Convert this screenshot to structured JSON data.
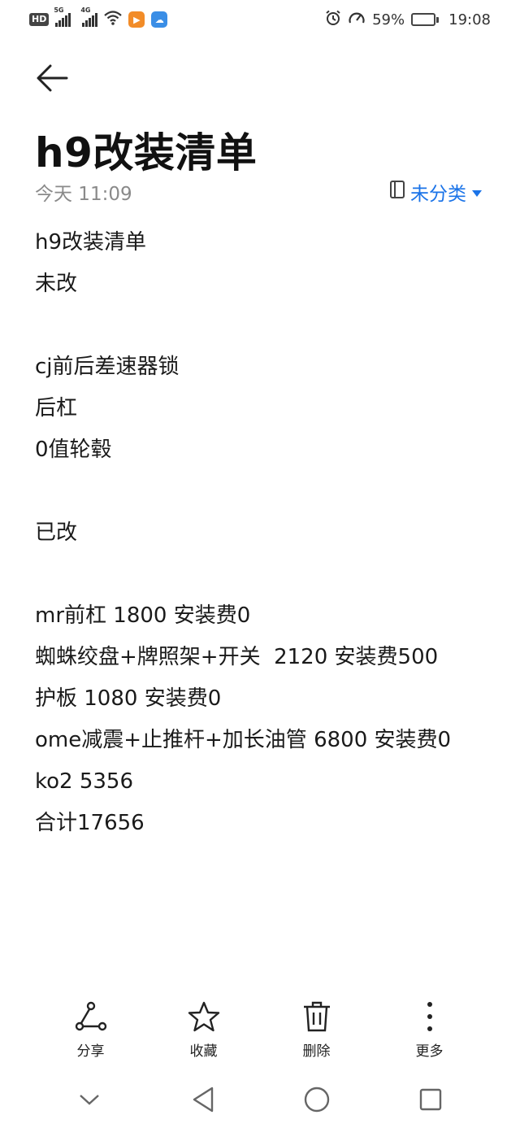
{
  "status_bar": {
    "hd": "HD",
    "sig1": "5G",
    "sig2": "4G",
    "app1_color": "#f28c28",
    "app2_color": "#3a8ee6",
    "battery_pct": "59%",
    "battery_level": 0.59,
    "time": "19:08"
  },
  "note": {
    "title": "h9改装清单",
    "time": "今天 11:09",
    "category": "未分类",
    "lines": [
      "h9改装清单",
      "未改",
      "",
      "cj前后差速器锁",
      "后杠",
      "0值轮毂",
      "",
      "已改",
      "",
      "mr前杠 1800 安装费0",
      "蜘蛛绞盘+牌照架+开关  2120 安装费500",
      "护板 1080 安装费0",
      "ome减震+止推杆+加长油管 6800 安装费0",
      "ko2 5356",
      "合计17656"
    ]
  },
  "toolbar": {
    "share": "分享",
    "favorite": "收藏",
    "delete": "删除",
    "more": "更多"
  },
  "colors": {
    "accent": "#1a73e8",
    "text": "#1a1a1a",
    "secondary": "#8a8a8a"
  },
  "icons": {
    "back": "arrow-left-icon",
    "category": "notebook-icon",
    "share": "share-icon",
    "favorite": "star-icon",
    "delete": "trash-icon",
    "more": "more-vertical-icon"
  }
}
